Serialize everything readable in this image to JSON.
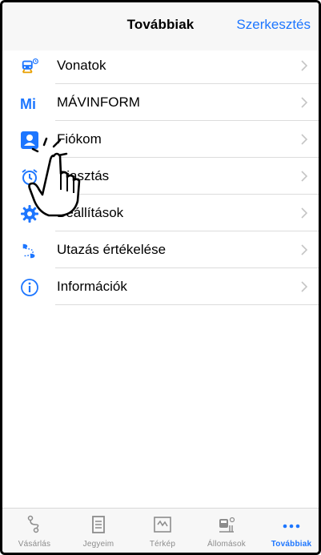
{
  "header": {
    "title": "Továbbiak",
    "edit_label": "Szerkesztés"
  },
  "menu": {
    "items": [
      {
        "label": "Vonatok",
        "icon": "train-icon"
      },
      {
        "label": "MÁVINFORM",
        "icon": "mavinform-logo-icon",
        "logo_text": "Mi"
      },
      {
        "label": "Fiókom",
        "icon": "account-icon"
      },
      {
        "label": "Riasztás",
        "icon": "alarm-icon"
      },
      {
        "label": "Beállítások",
        "icon": "gear-icon"
      },
      {
        "label": "Utazás értékelése",
        "icon": "journey-feedback-icon"
      },
      {
        "label": "Információk",
        "icon": "info-icon"
      }
    ]
  },
  "tabbar": {
    "tabs": [
      {
        "label": "Vásárlás",
        "icon": "route-icon",
        "active": false
      },
      {
        "label": "Jegyeim",
        "icon": "ticket-icon",
        "active": false
      },
      {
        "label": "Térkép",
        "icon": "map-icon",
        "active": false
      },
      {
        "label": "Állomások",
        "icon": "station-icon",
        "active": false
      },
      {
        "label": "Továbbiak",
        "icon": "more-icon",
        "active": true
      }
    ]
  },
  "colors": {
    "accent": "#1d76ff",
    "inactive": "#8c8c8c",
    "separator": "#dcdcdc"
  }
}
